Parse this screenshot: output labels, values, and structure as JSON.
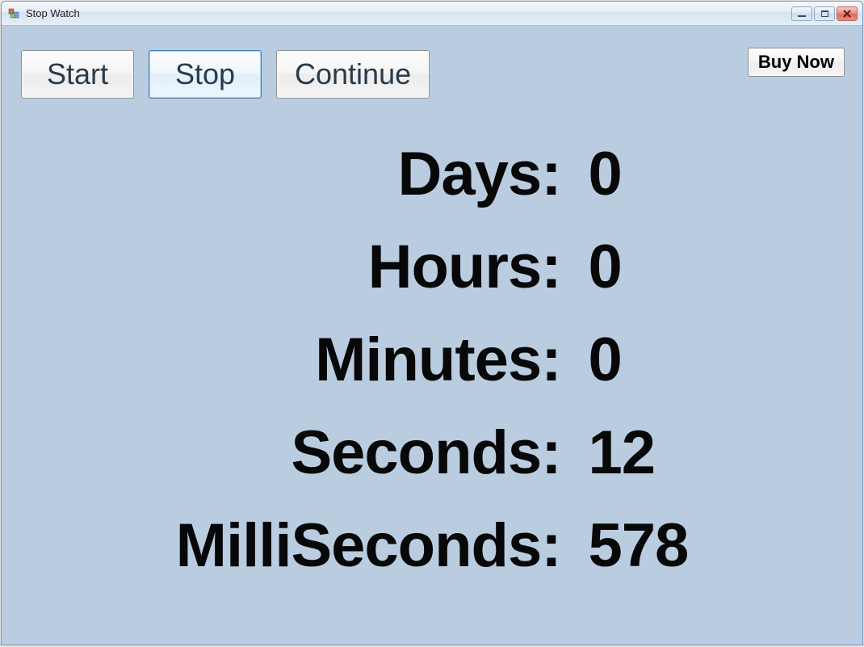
{
  "window": {
    "title": "Stop Watch"
  },
  "toolbar": {
    "start_label": "Start",
    "stop_label": "Stop",
    "continue_label": "Continue",
    "buy_now_label": "Buy Now"
  },
  "time": {
    "days_label": "Days:",
    "days_value": "0",
    "hours_label": "Hours:",
    "hours_value": "0",
    "minutes_label": "Minutes:",
    "minutes_value": "0",
    "seconds_label": "Seconds:",
    "seconds_value": "12",
    "milliseconds_label": "MilliSeconds:",
    "milliseconds_value": "578"
  }
}
